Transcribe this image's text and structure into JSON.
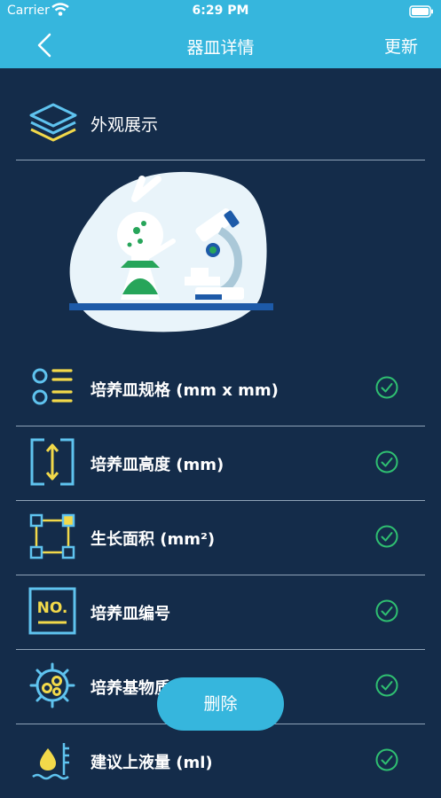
{
  "status_bar": {
    "carrier": "Carrier",
    "time": "6:29 PM"
  },
  "nav": {
    "title": "器皿详情",
    "update_label": "更新",
    "accent": "#36b6dd"
  },
  "section": {
    "title": "外观展示",
    "icon": "layers-icon"
  },
  "rows": [
    {
      "label": "培养皿规格 (mm x mm)",
      "icon": "spec-list-icon",
      "checked": true
    },
    {
      "label": "培养皿高度 (mm)",
      "icon": "height-icon",
      "checked": true
    },
    {
      "label": "生长面积 (mm²)",
      "icon": "area-icon",
      "checked": true
    },
    {
      "label": "培养皿编号",
      "icon": "number-icon",
      "checked": true
    },
    {
      "label": "培养基物质",
      "icon": "culture-icon",
      "checked": true
    },
    {
      "label": "建议上液量 (ml)",
      "icon": "liquid-icon",
      "checked": true
    }
  ],
  "delete_label": "删除",
  "colors": {
    "background": "#142c4a",
    "check": "#2fbf71",
    "icon_blue": "#5fc3ef",
    "icon_yellow": "#f2d94a"
  }
}
